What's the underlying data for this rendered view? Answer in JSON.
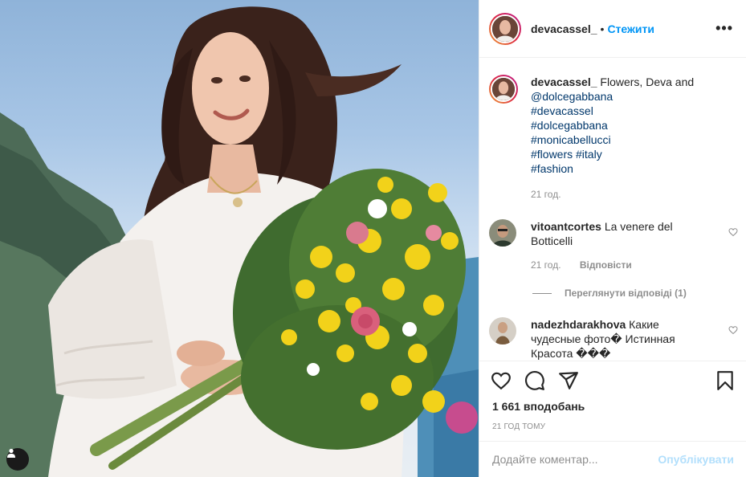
{
  "post": {
    "author": "devacassel_",
    "separator": "•",
    "follow_label": "Стежити",
    "more_label": "•••"
  },
  "caption": {
    "username": "devacassel_",
    "text": "Flowers, Deva and",
    "lines": [
      "@dolcegabbana",
      "#devacassel",
      "#dolcegabbana",
      "#monicabellucci",
      "#flowers #italy",
      "#fashion"
    ],
    "time": "21 год."
  },
  "comments": [
    {
      "username": "vitoantcortes",
      "text": "La venere del Botticelli",
      "time": "21 год.",
      "reply_label": "Відповісти",
      "view_replies": "Переглянути відповіді (1)"
    },
    {
      "username": "nadezhdarakhova",
      "text": "Какие чудесные фото� Истинная Красота ���"
    }
  ],
  "stats": {
    "likes": "1 661 вподобань",
    "time_ago": "21 ГОД ТОМУ"
  },
  "add_comment": {
    "placeholder": "Додайте коментар...",
    "publish_label": "Опублікувати"
  },
  "icons": [
    "user-tag-icon",
    "heart-icon",
    "comment-icon",
    "share-icon",
    "bookmark-icon",
    "more-icon"
  ],
  "colors": {
    "follow": "#0095f6",
    "publish_disabled": "#b2dffc",
    "hashtag": "#00376b"
  }
}
